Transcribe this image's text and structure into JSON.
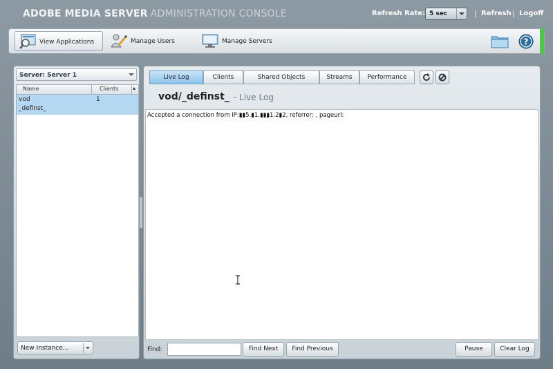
{
  "app": {
    "brand_bold": "ADOBE MEDIA SERVER",
    "brand_rest": "ADMINISTRATION CONSOLE"
  },
  "header": {
    "refresh_rate_label": "Refresh Rate:",
    "refresh_rate_value": "5 sec",
    "separator": "|",
    "refresh_link": "Refresh",
    "logoff_link": "Logoff"
  },
  "toolbar": {
    "view_applications": "View Applications",
    "manage_users": "Manage Users",
    "manage_servers": "Manage Servers"
  },
  "left_panel": {
    "server_select": "Server: Server 1",
    "columns": [
      "Name",
      "Clients"
    ],
    "rows": [
      {
        "name_line1": "vod",
        "name_line2": "_definst_",
        "clients": "1"
      }
    ],
    "new_instance_button": "New Instance..."
  },
  "right_panel": {
    "tabs": [
      "Live Log",
      "Clients",
      "Shared Objects",
      "Streams",
      "Performance"
    ],
    "active_tab": "Live Log",
    "instance_title": "vod/_definst_",
    "view_subtitle": "- Live Log",
    "log_lines": [
      "Accepted a connection from IP:▮▮5.▮1.▮▮▮1.2▮2, referrer: , pageurl:"
    ],
    "find_label": "Find:",
    "find_value": "",
    "find_next": "Find Next",
    "find_previous": "Find Previous",
    "pause": "Pause",
    "clear_log": "Clear Log"
  },
  "colors": {
    "active_tab": "#8cc3ea",
    "selected_row": "#b4d8f2",
    "status_green": "#4ec64a"
  },
  "icons": [
    "view-applications-icon",
    "manage-users-icon",
    "manage-servers-icon",
    "folder-icon",
    "help-icon",
    "refresh-icon",
    "stop-icon",
    "text-cursor-icon"
  ]
}
